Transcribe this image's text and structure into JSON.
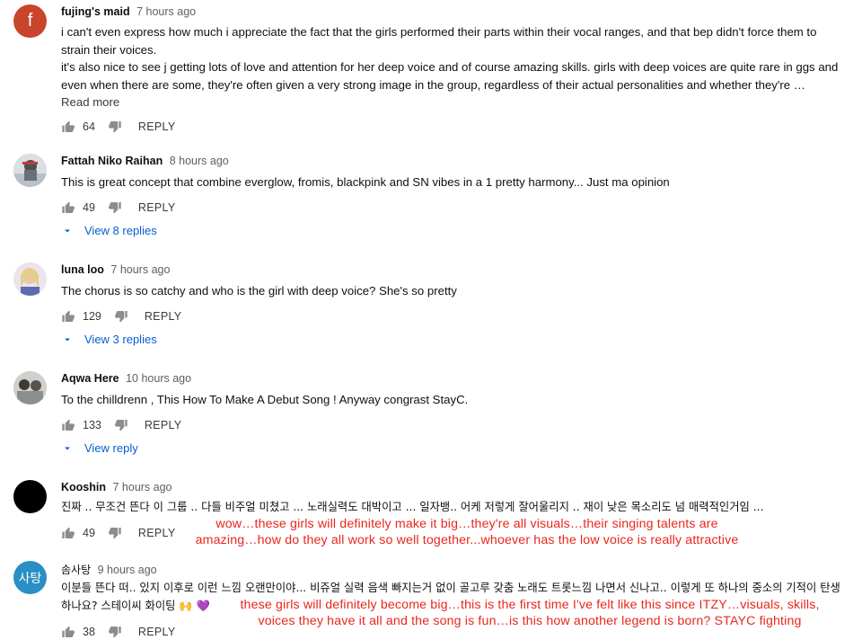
{
  "comments": [
    {
      "author": "fujing's maid",
      "time": "7 hours ago",
      "avatar_letter": "f",
      "avatar_color": "#c8442a",
      "text1": "i can't even express how much i appreciate the fact that the girls performed their parts within their vocal ranges, and that bep didn't force them to strain their voices.",
      "text2": "it's also nice to see j getting lots of love and attention for her deep voice and of course amazing skills. girls with deep voices are quite rare in ggs and even when there are some, they're often given a very strong image in the group, regardless of their actual personalities and whether they're …",
      "read_more": "Read more",
      "likes": "64",
      "reply": "REPLY"
    },
    {
      "author": "Fattah Niko Raihan",
      "time": "8 hours ago",
      "text": "This is great concept that combine everglow, fromis, blackpink and SN vibes in a 1 pretty harmony... Just ma opinion",
      "likes": "49",
      "reply": "REPLY",
      "view_replies": "View 8 replies"
    },
    {
      "author": "luna loo",
      "time": "7 hours ago",
      "text": "The chorus is so catchy and who is the girl with deep voice? She's so pretty",
      "likes": "129",
      "reply": "REPLY",
      "view_replies": "View 3 replies"
    },
    {
      "author": "Aqwa Here",
      "time": "10 hours ago",
      "text": "To the chilldrenn , This How To Make A Debut Song ! Anyway congrast StayC.",
      "likes": "133",
      "reply": "REPLY",
      "view_replies": "View reply"
    },
    {
      "author": "Kooshin",
      "time": "7 hours ago",
      "text": "진짜 .. 무조건 뜬다 이 그룹 .. 다들 비주얼 미쳤고 ... 노래실력도 대박이고 ... 일자뱅.. 어케 저렇게 잘어울리지 .. 재이 낮은 목소리도 넘 매력적인거임 ...",
      "likes": "49",
      "reply": "REPLY",
      "translation1": "wow…these girls will definitely make it big…they're all visuals…their singing talents are",
      "translation2": "amazing…how do they all work so well together...whoever has the low voice is really attractive"
    },
    {
      "author": "솜사탕",
      "time": "9 hours ago",
      "avatar_text": "사탕",
      "avatar_color": "#2a8fc4",
      "text1": "이분들 뜬다 떠.. 있지 이후로 이런 느낌 오랜만이야... 비쥬얼 실력 음색 빠지는거 없이 골고루 갖춤 노래도 트롯느낌 나면서 신나고.. 이렇게 또 하나의 중소의 기적이 탄생",
      "text2": "하나요? 스테이씨 화이팅",
      "emoji": "🙌 💜",
      "likes": "38",
      "reply": "REPLY",
      "translation1": "these girls will definitely become big…this is the first time I've felt like this since ITZY…visuals, skills,",
      "translation2": "voices they have it all and the song is fun…is this how another legend is born? STAYC fighting"
    }
  ],
  "colors": {
    "link": "#065fd4",
    "annotation": "#e8271c",
    "meta": "#606060"
  }
}
